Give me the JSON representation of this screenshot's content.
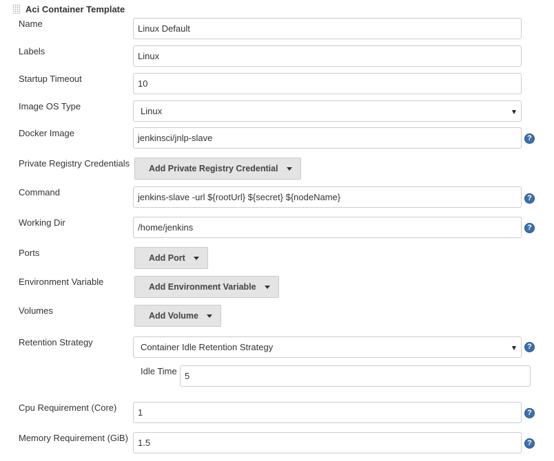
{
  "section": {
    "title": "Aci Container Template"
  },
  "fields": {
    "name": {
      "label": "Name",
      "value": "Linux Default"
    },
    "labels": {
      "label": "Labels",
      "value": "Linux"
    },
    "startup_timeout": {
      "label": "Startup Timeout",
      "value": "10"
    },
    "image_os_type": {
      "label": "Image OS Type",
      "value": "Linux"
    },
    "docker_image": {
      "label": "Docker Image",
      "value": "jenkinsci/jnlp-slave"
    },
    "private_registry_credentials": {
      "label": "Private Registry Credentials",
      "button": "Add Private Registry Credential"
    },
    "command": {
      "label": "Command",
      "value": "jenkins-slave -url ${rootUrl} ${secret} ${nodeName}"
    },
    "working_dir": {
      "label": "Working Dir",
      "value": "/home/jenkins"
    },
    "ports": {
      "label": "Ports",
      "button": "Add Port"
    },
    "environment_variable": {
      "label": "Environment Variable",
      "button": "Add Environment Variable"
    },
    "volumes": {
      "label": "Volumes",
      "button": "Add Volume"
    },
    "retention_strategy": {
      "label": "Retention Strategy",
      "value": "Container Idle Retention Strategy"
    },
    "idle_time": {
      "label": "Idle Time",
      "value": "5"
    },
    "cpu_requirement": {
      "label": "Cpu Requirement (Core)",
      "value": "1"
    },
    "memory_requirement": {
      "label": "Memory Requirement (GiB)",
      "value": "1.5"
    }
  },
  "help_glyph": "?",
  "icons": {
    "drag_handle": "drag-handle-icon",
    "help": "help-icon",
    "dropdown": "dropdown-arrow-icon",
    "caret": "caret-down-icon"
  },
  "colors": {
    "help_icon": "#3d6fa5",
    "button_bg": "#e4e4e4",
    "input_border": "#cccccc"
  }
}
